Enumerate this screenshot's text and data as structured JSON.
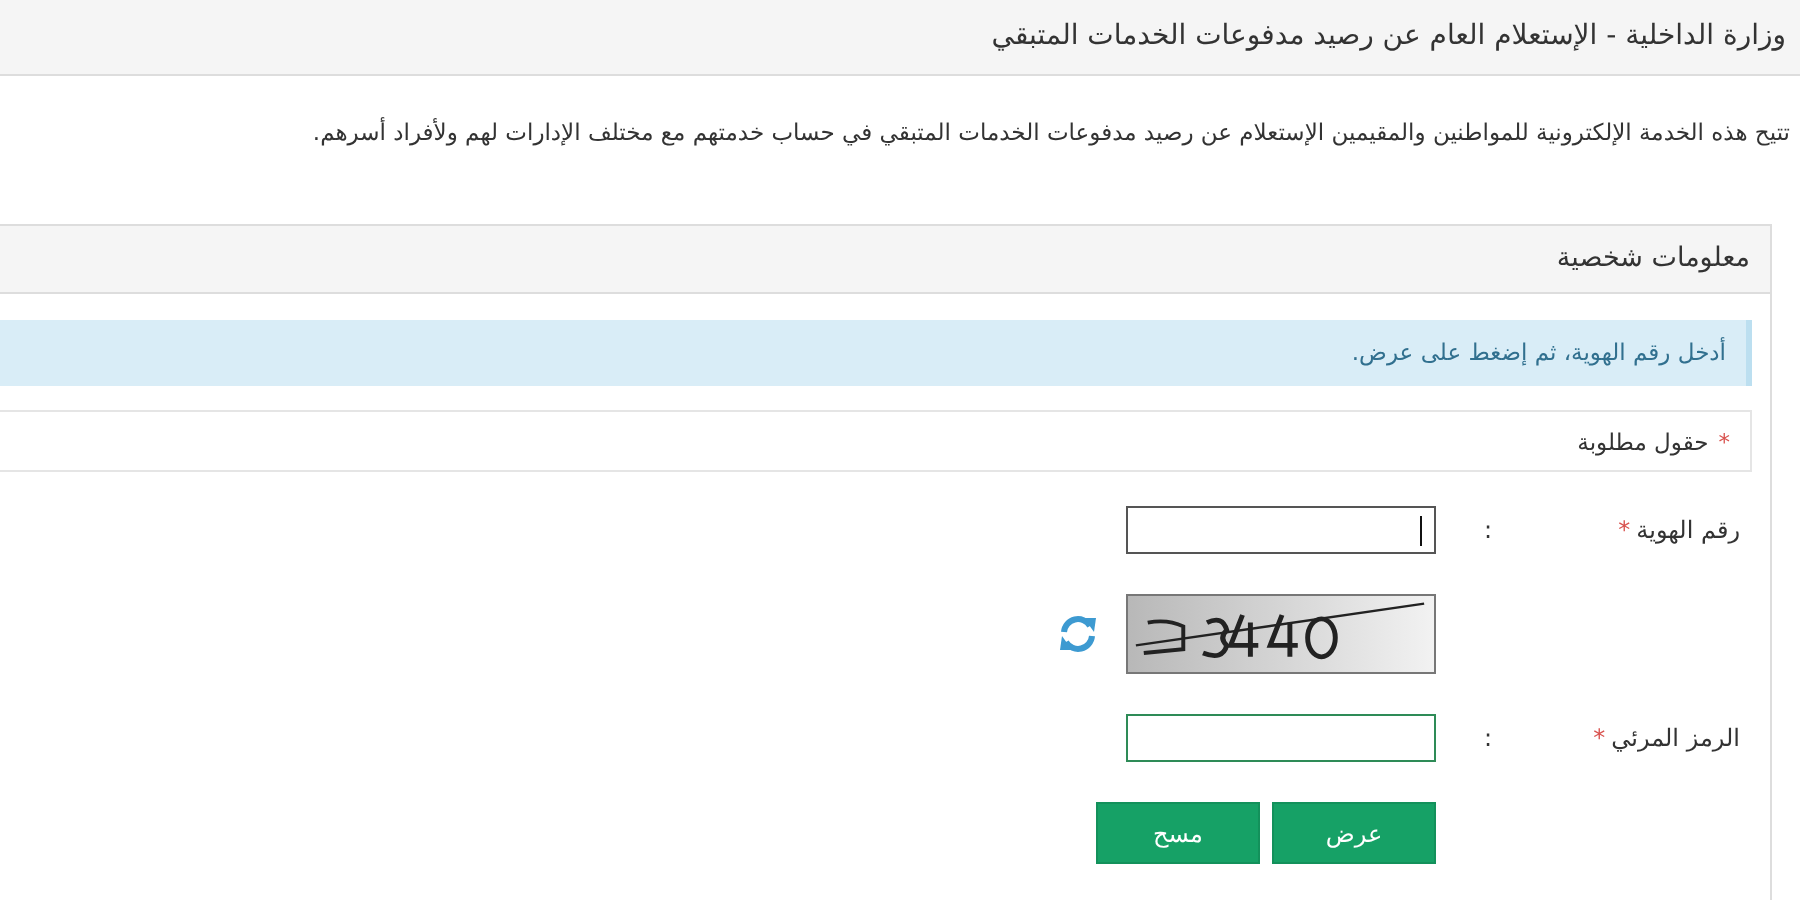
{
  "page": {
    "title": "وزارة الداخلية - الإستعلام العام عن رصيد مدفوعات الخدمات المتبقي",
    "description": "تتيح هذه الخدمة الإلكترونية للمواطنين والمقيمين الإستعلام عن رصيد مدفوعات الخدمات المتبقي في حساب خدمتهم مع مختلف الإدارات لهم ولأفراد أسرهم."
  },
  "panel": {
    "heading": "معلومات شخصية",
    "info": "أدخل رقم الهوية، ثم إضغط على عرض.",
    "required_note": {
      "marker": "*",
      "text": "حقول مطلوبة"
    }
  },
  "fields": [
    {
      "kind": "input",
      "label": "رقم الهوية",
      "marker": "*",
      "separator": ":",
      "focused": true
    },
    {
      "kind": "captcha"
    },
    {
      "kind": "input",
      "label": "الرمز المرئي",
      "marker": "*",
      "separator": ":",
      "focused": false
    }
  ],
  "buttons": [
    {
      "label": "عرض"
    },
    {
      "label": "مسح"
    }
  ]
}
